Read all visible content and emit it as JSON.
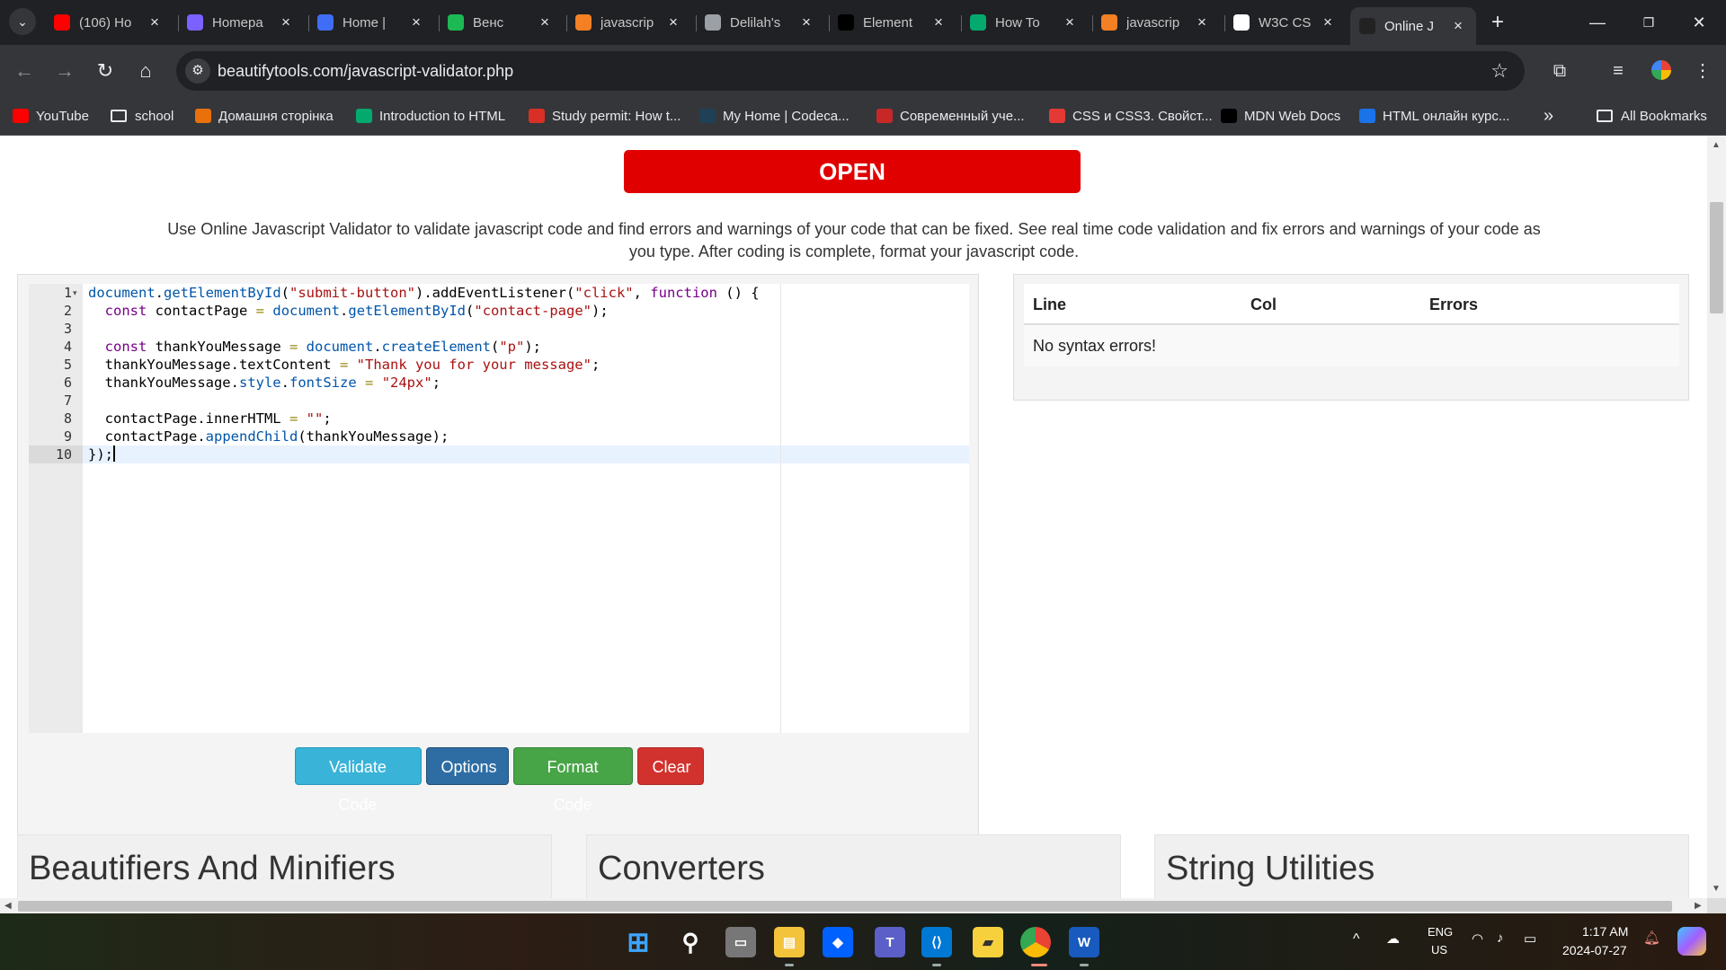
{
  "browser": {
    "tabs": [
      {
        "title": "(106) Ho",
        "icon": "youtube-icon",
        "color": "#ff0000"
      },
      {
        "title": "Homepa",
        "icon": "app-icon",
        "color": "#7b61ff"
      },
      {
        "title": "Home |",
        "icon": "copilot-icon",
        "color": "#3f6df5"
      },
      {
        "title": "Венс",
        "icon": "spotify-icon",
        "color": "#1db954"
      },
      {
        "title": "javascrip",
        "icon": "stackoverflow-icon",
        "color": "#f48024"
      },
      {
        "title": "Delilah's",
        "icon": "globe-icon",
        "color": "#9aa0a6"
      },
      {
        "title": "Element",
        "icon": "mdn-icon",
        "color": "#000000"
      },
      {
        "title": "How To",
        "icon": "w3-icon",
        "color": "#04aa6d"
      },
      {
        "title": "javascrip",
        "icon": "stackoverflow-icon",
        "color": "#f48024"
      },
      {
        "title": "W3C CS",
        "icon": "w3c-icon",
        "color": "#ffffff"
      },
      {
        "title": "Online J",
        "icon": "bt-icon",
        "color": "#222222",
        "active": true
      }
    ],
    "url": "beautifytools.com/javascript-validator.php",
    "bookmarks": [
      {
        "label": "YouTube",
        "icon": "youtube-icon"
      },
      {
        "label": "school",
        "icon": "folder-icon"
      },
      {
        "label": "Домашня сторінка",
        "icon": "site-icon"
      },
      {
        "label": "Introduction to HTML",
        "icon": "w3-icon"
      },
      {
        "label": "Study permit: How t...",
        "icon": "canada-icon"
      },
      {
        "label": "My Home | Codeca...",
        "icon": "codecademy-icon"
      },
      {
        "label": "Современный уче...",
        "icon": "js-icon"
      },
      {
        "label": "CSS и CSS3. Свойст...",
        "icon": "site-icon"
      },
      {
        "label": "MDN Web Docs",
        "icon": "mdn-icon"
      },
      {
        "label": "HTML онлайн курс...",
        "icon": "course-icon"
      }
    ],
    "all_bookmarks_label": "All Bookmarks"
  },
  "page": {
    "open_button": "OPEN",
    "description": "Use Online Javascript Validator to validate javascript code and find errors and warnings of your code that can be fixed. See real time code validation and fix errors and warnings of your code as you type. After coding is complete, format your javascript code.",
    "code_lines": [
      "document.getElementById(\"submit-button\").addEventListener(\"click\", function () {",
      "  const contactPage = document.getElementById(\"contact-page\");",
      "",
      "  const thankYouMessage = document.createElement(\"p\");",
      "  thankYouMessage.textContent = \"Thank you for your message\";",
      "  thankYouMessage.style.fontSize = \"24px\";",
      "",
      "  contactPage.innerHTML = \"\";",
      "  contactPage.appendChild(thankYouMessage);",
      "});"
    ],
    "line_numbers": [
      "1",
      "2",
      "3",
      "4",
      "5",
      "6",
      "7",
      "8",
      "9",
      "10"
    ],
    "buttons": {
      "validate": "Validate Code",
      "options": "Options",
      "format": "Format Code",
      "clear": "Clear"
    },
    "results": {
      "headers": [
        "Line",
        "Col",
        "Errors"
      ],
      "message": "No syntax errors!"
    },
    "cards": [
      "Beautifiers And Minifiers",
      "Converters",
      "String Utilities"
    ]
  },
  "taskbar": {
    "lang": "ENG",
    "region": "US",
    "time": "1:17 AM",
    "date": "2024-07-27"
  }
}
